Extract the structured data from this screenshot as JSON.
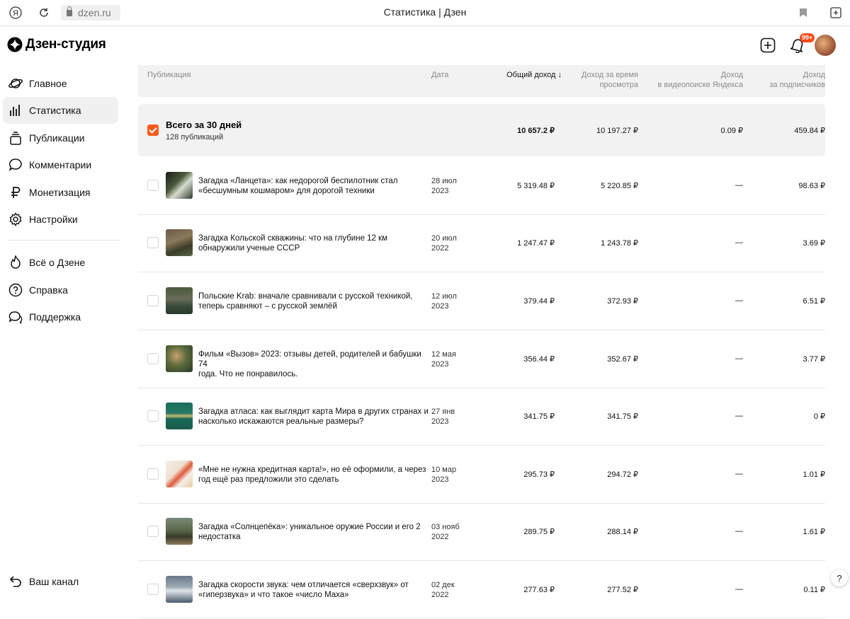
{
  "browser": {
    "url": "dzen.ru",
    "tab_title": "Статистика | Дзен"
  },
  "logo": {
    "text": "Дзен-студия"
  },
  "nav": {
    "main": [
      {
        "label": "Главное",
        "icon": "planet-icon"
      },
      {
        "label": "Статистика",
        "icon": "stats-icon",
        "active": true
      },
      {
        "label": "Публикации",
        "icon": "publications-icon"
      },
      {
        "label": "Комментарии",
        "icon": "comment-icon"
      },
      {
        "label": "Монетизация",
        "icon": "ruble-icon"
      },
      {
        "label": "Настройки",
        "icon": "gear-icon"
      }
    ],
    "secondary": [
      {
        "label": "Всё о Дзене",
        "icon": "fire-icon"
      },
      {
        "label": "Справка",
        "icon": "question-icon"
      },
      {
        "label": "Поддержка",
        "icon": "chat-icon"
      }
    ],
    "bottom": {
      "label": "Ваш канал",
      "icon": "back-arrow-icon"
    }
  },
  "header": {
    "notifications_badge": "99+"
  },
  "table": {
    "headers": {
      "publication": "Публикация",
      "date": "Дата",
      "total": "Общий доход",
      "total_sort": "↓",
      "watch_1": "Доход за время",
      "watch_2": "просмотра",
      "video_1": "Доход",
      "video_2": "в видеопоиске Яндекса",
      "subs_1": "Доход",
      "subs_2": "за подписчиков"
    },
    "total": {
      "title": "Всего за 30 дней",
      "subtitle": "128 публикаций",
      "total": "10 657.2 ₽",
      "watch": "10 197.27 ₽",
      "video": "0.09 ₽",
      "subs": "459.84 ₽"
    },
    "rows": [
      {
        "title_1": "Загадка «Ланцета»: как недорогой беспилотник стал",
        "title_2": "«бесшумным кошмаром» для дорогой техники",
        "date_1": "28 июл",
        "date_2": "2023",
        "total": "5 319.48 ₽",
        "watch": "5 220.85 ₽",
        "video": "—",
        "subs": "98.63 ₽"
      },
      {
        "title_1": "Загадка Кольской скважины: что на глубине 12 км",
        "title_2": "обнаружили ученые СССР",
        "date_1": "20 июл",
        "date_2": "2022",
        "total": "1 247.47 ₽",
        "watch": "1 243.78 ₽",
        "video": "—",
        "subs": "3.69 ₽"
      },
      {
        "title_1": "Польские Krab: вначале сравнивали с русской техникой,",
        "title_2": "теперь сравняют – с русской землёй",
        "date_1": "12 июл",
        "date_2": "2023",
        "total": "379.44 ₽",
        "watch": "372.93 ₽",
        "video": "—",
        "subs": "6.51 ₽"
      },
      {
        "title_1": "Фильм «Вызов» 2023: отзывы детей, родителей и бабушки 74",
        "title_2": "года. Что не понравилось.",
        "date_1": "12 мая",
        "date_2": "2023",
        "total": "356.44 ₽",
        "watch": "352.67 ₽",
        "video": "—",
        "subs": "3.77 ₽"
      },
      {
        "title_1": "Загадка атласа: как выглядит карта Мира в других странах и",
        "title_2": "насколько искажаются реальные размеры?",
        "date_1": "27 янв",
        "date_2": "2023",
        "total": "341.75 ₽",
        "watch": "341.75 ₽",
        "video": "—",
        "subs": "0 ₽"
      },
      {
        "title_1": "«Мне не нужна кредитная карта!», но её оформили, а через",
        "title_2": "год ещё раз предложили это сделать",
        "date_1": "10 мар",
        "date_2": "2023",
        "total": "295.73 ₽",
        "watch": "294.72 ₽",
        "video": "—",
        "subs": "1.01 ₽"
      },
      {
        "title_1": "Загадка «Солнцепёка»: уникальное оружие России и его 2",
        "title_2": "недостатка",
        "date_1": "03 нояб",
        "date_2": "2022",
        "total": "289.75 ₽",
        "watch": "288.14 ₽",
        "video": "—",
        "subs": "1.61 ₽"
      },
      {
        "title_1": "Загадка скорости звука: чем отличается «сверхзвук» от",
        "title_2": "«гиперзвука» и что такое «число Маха»",
        "date_1": "02 дек",
        "date_2": "2022",
        "total": "277.63 ₽",
        "watch": "277.52 ₽",
        "video": "—",
        "subs": "0.11 ₽"
      }
    ]
  },
  "help": "?"
}
